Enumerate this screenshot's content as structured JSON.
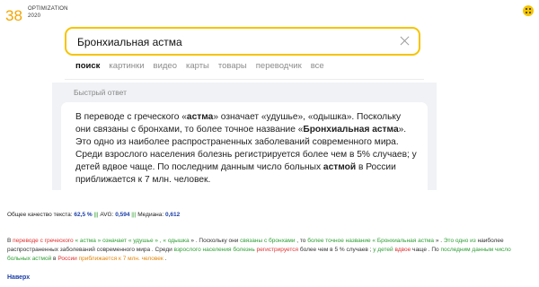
{
  "header": {
    "page_number": "38",
    "brand_line1": "OPTIMIZATION",
    "brand_line2": "2020"
  },
  "search": {
    "query": "Бронхиальная астма",
    "tabs": [
      {
        "label": "поиск",
        "active": true
      },
      {
        "label": "картинки",
        "active": false
      },
      {
        "label": "видео",
        "active": false
      },
      {
        "label": "карты",
        "active": false
      },
      {
        "label": "товары",
        "active": false
      },
      {
        "label": "переводчик",
        "active": false
      },
      {
        "label": "все",
        "active": false
      }
    ]
  },
  "answer": {
    "title": "Быстрый ответ",
    "segments": [
      {
        "text": "В переводе с греческого «",
        "bold": false
      },
      {
        "text": "астма",
        "bold": true
      },
      {
        "text": "» означает «удушье», «одышка». Поскольку они связаны с бронхами, то более точное название «",
        "bold": false
      },
      {
        "text": "Бронхиальная астма",
        "bold": true
      },
      {
        "text": "». Это одно из наиболее распространенных заболеваний современного мира. Среди взрослого населения болезнь регистрируется более чем в 5% случаев; у детей вдвое чаще. По последним данным число больных ",
        "bold": false
      },
      {
        "text": "астмой",
        "bold": true
      },
      {
        "text": " в России приближается к 7 млн. человек.",
        "bold": false
      }
    ]
  },
  "quality": {
    "label": "Общее качество текста:",
    "overall": "62,5 %",
    "sep1": " ||| ",
    "avg_label": "AVG:",
    "avg": "0,594",
    "sep2": " ||| ",
    "median_label": "Медиана:",
    "median": "0,612"
  },
  "analysis": {
    "colors": {
      "red": "#e03030",
      "green": "#2e9d34",
      "orange": "#e0860c"
    },
    "tokens": [
      {
        "t": "В ",
        "c": "plain"
      },
      {
        "t": "переводе с греческого",
        "c": "red"
      },
      {
        "t": " « ",
        "c": "green"
      },
      {
        "t": "астма",
        "c": "green"
      },
      {
        "t": " » ",
        "c": "green"
      },
      {
        "t": "означает",
        "c": "green"
      },
      {
        "t": " « ",
        "c": "green"
      },
      {
        "t": "удушье",
        "c": "green"
      },
      {
        "t": " » , « ",
        "c": "green"
      },
      {
        "t": "одышка",
        "c": "green"
      },
      {
        "t": " » . Поскольку они ",
        "c": "plain"
      },
      {
        "t": "связаны с бронхами",
        "c": "green"
      },
      {
        "t": " , то ",
        "c": "plain"
      },
      {
        "t": "более точное название",
        "c": "green"
      },
      {
        "t": " « ",
        "c": "green"
      },
      {
        "t": "Бронхиальная астма",
        "c": "green"
      },
      {
        "t": " » . ",
        "c": "plain"
      },
      {
        "t": "Это одно из",
        "c": "green"
      },
      {
        "t": " наиболее распространенных заболеваний современного мира . Среди ",
        "c": "plain"
      },
      {
        "t": "взрослого населения болезнь",
        "c": "green"
      },
      {
        "t": " ",
        "c": "plain"
      },
      {
        "t": "регистрируется",
        "c": "red"
      },
      {
        "t": " более чем в 5 % случаев ; ",
        "c": "plain"
      },
      {
        "t": "у детей",
        "c": "green"
      },
      {
        "t": " ",
        "c": "plain"
      },
      {
        "t": "вдвое",
        "c": "red"
      },
      {
        "t": " чаще . По ",
        "c": "plain"
      },
      {
        "t": "последним данным число больных астмой",
        "c": "green"
      },
      {
        "t": " в ",
        "c": "plain"
      },
      {
        "t": "России",
        "c": "red"
      },
      {
        "t": " ",
        "c": "plain"
      },
      {
        "t": "приближается к 7 млн. человек",
        "c": "orange"
      },
      {
        "t": " .",
        "c": "plain"
      }
    ]
  },
  "footer": {
    "top_link": "Наверх"
  }
}
